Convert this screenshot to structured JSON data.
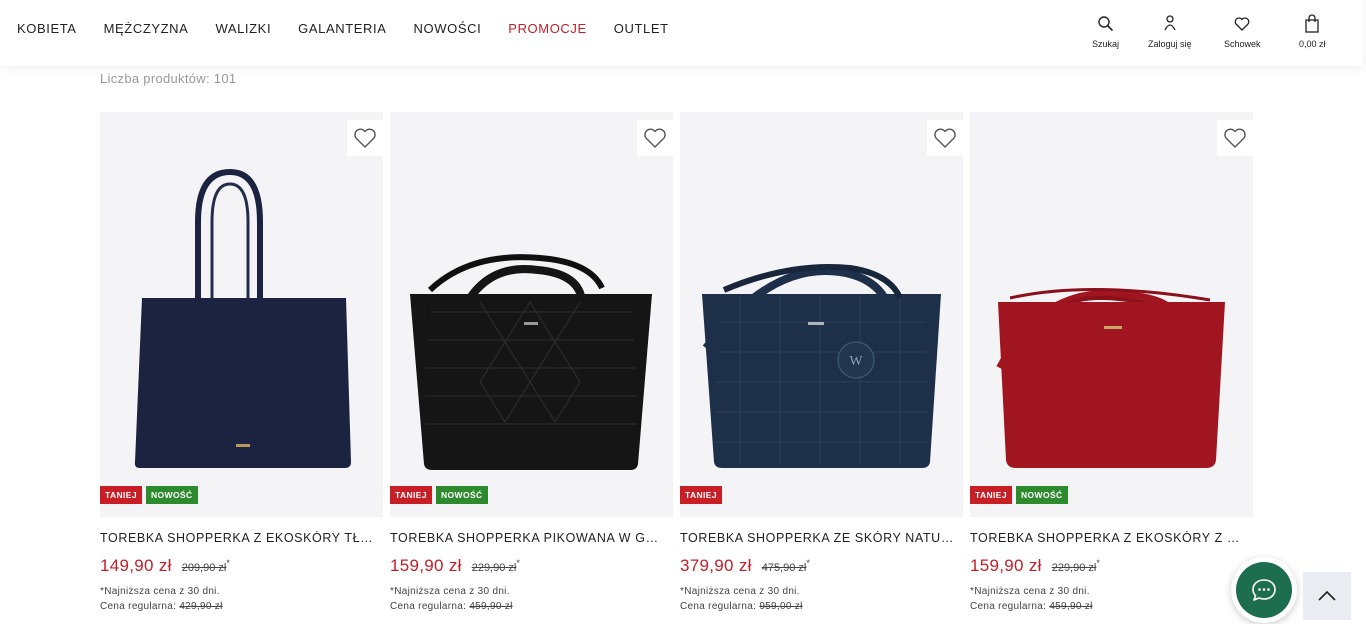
{
  "nav": [
    {
      "label": "KOBIETA",
      "color": "#222222"
    },
    {
      "label": "MĘŻCZYZNA",
      "color": "#222222"
    },
    {
      "label": "WALIZKI",
      "color": "#222222"
    },
    {
      "label": "GALANTERIA",
      "color": "#222222"
    },
    {
      "label": "NOWOŚCI",
      "color": "#222222"
    },
    {
      "label": "PROMOCJE",
      "color": "#c0202a"
    },
    {
      "label": "OUTLET",
      "color": "#222222"
    }
  ],
  "utility": {
    "search": {
      "label": "Szukaj",
      "icon": "search-icon"
    },
    "login": {
      "label": "Zaloguj się",
      "icon": "user-icon"
    },
    "wishlist": {
      "label": "Schowek",
      "icon": "heart-icon"
    },
    "cart": {
      "label": "0,00 zł",
      "icon": "shopping-bag-icon"
    }
  },
  "product_count": "Liczba produktów: 101",
  "products": [
    {
      "name": "TOREBKA SHOPPERKA Z EKOSKÓRY TŁOCZONEJ",
      "price": "149,90 zł",
      "old_price": "209,90 zł",
      "star": "*",
      "note": "*Najniższa cena z 30 dni.",
      "regular_label": "Cena regularna:",
      "regular_price": "429,90 zł",
      "badges": [
        "TANIEJ",
        "NOWOŚĆ"
      ],
      "bag_color": "#1c2340"
    },
    {
      "name": "TOREBKA SHOPPERKA PIKOWANA W GEOMETRYCZNY WZÓR",
      "price": "159,90 zł",
      "old_price": "229,90 zł",
      "star": "*",
      "note": "*Najniższa cena z 30 dni.",
      "regular_label": "Cena regularna:",
      "regular_price": "459,90 zł",
      "badges": [
        "TANIEJ",
        "NOWOŚĆ"
      ],
      "bag_color": "#151515"
    },
    {
      "name": "TOREBKA SHOPPERKA ZE SKÓRY NATURALNEJ",
      "price": "379,90 zł",
      "old_price": "475,90 zł",
      "star": "*",
      "note": "*Najniższa cena z 30 dni.",
      "regular_label": "Cena regularna:",
      "regular_price": "959,00 zł",
      "badges": [
        "TANIEJ"
      ],
      "bag_color": "#1e3049"
    },
    {
      "name": "TOREBKA SHOPPERKA Z EKOSKÓRY Z OZDOBNYM",
      "price": "159,90 zł",
      "old_price": "229,90 zł",
      "star": "*",
      "note": "*Najniższa cena z 30 dni.",
      "regular_label": "Cena regularna:",
      "regular_price": "459,90 zł",
      "badges": [
        "TANIEJ",
        "NOWOŚĆ"
      ],
      "bag_color": "#a0151f"
    }
  ],
  "colors": {
    "accent_red": "#c0202a",
    "badge_sale": "#c81e26",
    "badge_new": "#2d8a2d",
    "chat_green": "#1d6e4e"
  }
}
